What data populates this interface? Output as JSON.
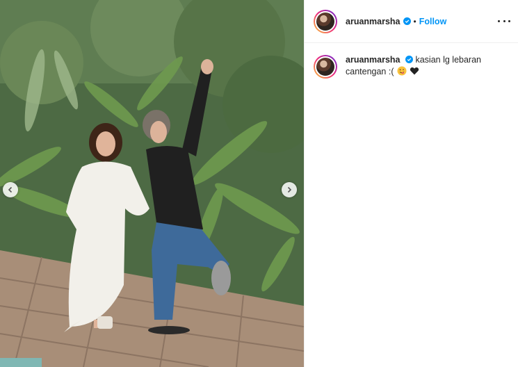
{
  "post": {
    "username": "aruanmarsha",
    "dot": "•",
    "follow_label": "Follow",
    "caption": "kasian lg lebaran cantengan :(",
    "caption_emojis": [
      "winking-face-with-tongue-emoji",
      "black-heart-emoji"
    ],
    "verified_icon": "verified-badge-icon",
    "more_icon": "more-options-icon"
  },
  "photo": {
    "description_icon": "post-photo",
    "nav": {
      "prev_icon": "chevron-left-icon",
      "next_icon": "chevron-right-icon"
    }
  },
  "colors": {
    "accent": "#0095f6",
    "text": "#262626",
    "border": "#efefef"
  }
}
